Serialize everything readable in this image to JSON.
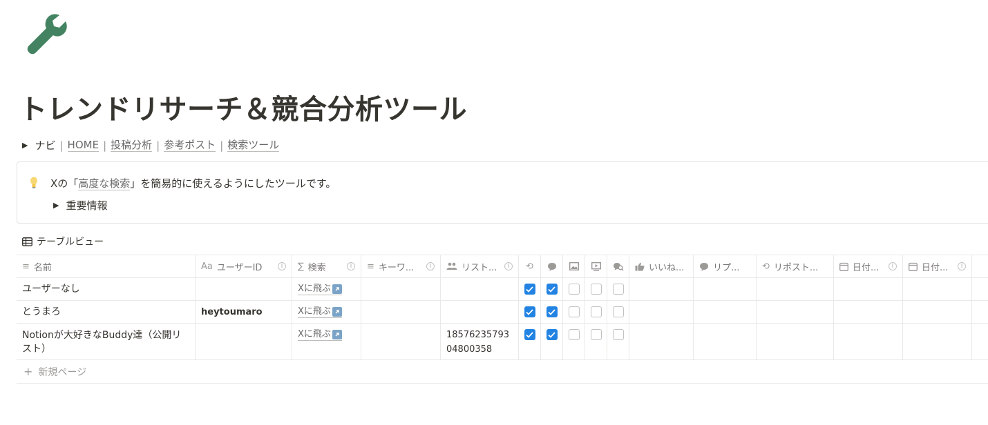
{
  "page": {
    "icon": "wrench-icon",
    "icon_color": "#448361",
    "title": "トレンドリサーチ＆競合分析ツール"
  },
  "nav": {
    "label": "ナビ",
    "separator": "|",
    "links": [
      "HOME",
      "投稿分析",
      "参考ポスト",
      "検索ツール"
    ]
  },
  "callout": {
    "icon": "lightbulb-icon",
    "text_before": "Xの「",
    "link": "高度な検索",
    "text_after": "」を簡易的に使えるようにしたツールです。",
    "toggle_label": "重要情報"
  },
  "view": {
    "icon": "table-icon",
    "label": "テーブルビュー"
  },
  "table": {
    "columns": [
      {
        "icon": "text-lines-icon",
        "label": "名前",
        "info": false
      },
      {
        "icon": "text-aa-icon",
        "label": "ユーザーID",
        "info": true
      },
      {
        "icon": "sigma-icon",
        "label": "検索",
        "info": true
      },
      {
        "icon": "text-lines-icon",
        "label": "キーワ...",
        "info": true
      },
      {
        "icon": "people-icon",
        "label": "リスト...",
        "info": true
      },
      {
        "icon": "repost-icon",
        "label": "",
        "info": false
      },
      {
        "icon": "speech-bubble-icon",
        "label": "",
        "info": false
      },
      {
        "icon": "image-icon",
        "label": "",
        "info": false
      },
      {
        "icon": "video-icon",
        "label": "",
        "info": false
      },
      {
        "icon": "quote-search-icon",
        "label": "",
        "info": false
      },
      {
        "icon": "thumbs-up-icon",
        "label": "いいね...",
        "info": false
      },
      {
        "icon": "speech-bubble-icon",
        "label": "リプ...",
        "info": false
      },
      {
        "icon": "repost-icon",
        "label": "リポスト...",
        "info": false
      },
      {
        "icon": "calendar-icon",
        "label": "日付...",
        "info": true
      },
      {
        "icon": "calendar-icon",
        "label": "日付...",
        "info": true
      }
    ],
    "rows": [
      {
        "name": "ユーザーなし",
        "user_id": "",
        "search": "Xに飛ぶ",
        "keyword": "",
        "list": "",
        "checks": [
          true,
          true,
          false,
          false,
          false
        ]
      },
      {
        "name": "とうまろ",
        "user_id": "heytoumaro",
        "search": "Xに飛ぶ",
        "keyword": "",
        "list": "",
        "checks": [
          true,
          true,
          false,
          false,
          false
        ]
      },
      {
        "name": "Notionが大好きなBuddy達（公開リスト）",
        "user_id": "",
        "search": "Xに飛ぶ",
        "keyword": "",
        "list": "1857623579304800358",
        "checks": [
          true,
          true,
          false,
          false,
          false
        ]
      }
    ],
    "new_page_label": "新規ページ"
  },
  "colors": {
    "accent_blue": "#2383e2",
    "text": "#37352f",
    "muted": "#787774",
    "border": "#e9e9e7"
  }
}
